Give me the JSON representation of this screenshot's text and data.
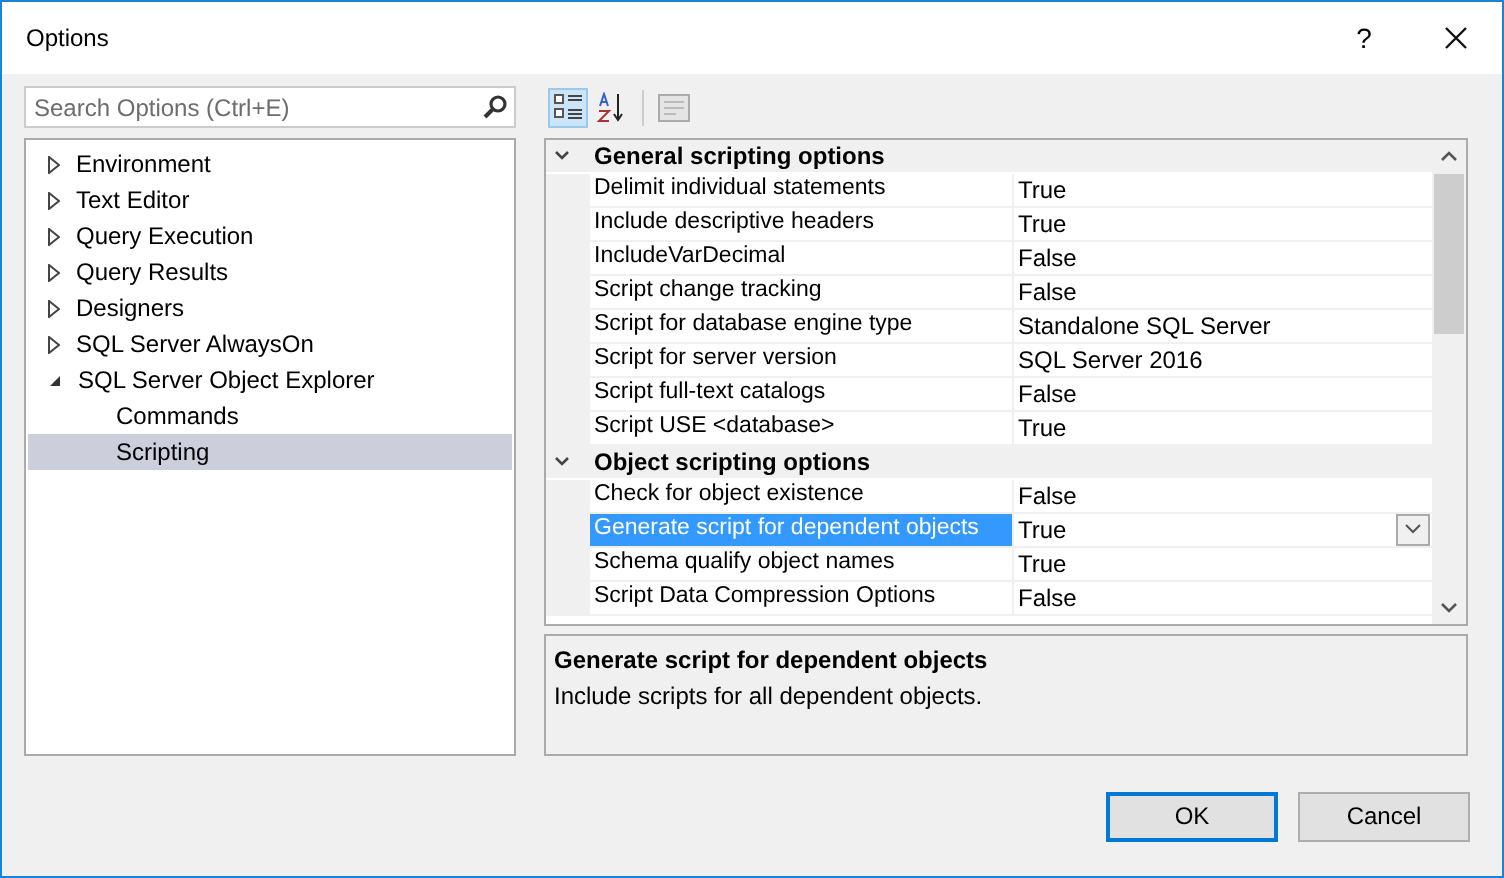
{
  "window": {
    "title": "Options",
    "help": "?"
  },
  "search": {
    "placeholder": "Search Options (Ctrl+E)"
  },
  "tree": [
    {
      "label": "Environment",
      "expanded": false,
      "selected": false
    },
    {
      "label": "Text Editor",
      "expanded": false,
      "selected": false
    },
    {
      "label": "Query Execution",
      "expanded": false,
      "selected": false
    },
    {
      "label": "Query Results",
      "expanded": false,
      "selected": false
    },
    {
      "label": "Designers",
      "expanded": false,
      "selected": false
    },
    {
      "label": "SQL Server AlwaysOn",
      "expanded": false,
      "selected": false
    },
    {
      "label": "SQL Server Object Explorer",
      "expanded": true,
      "selected": false,
      "children": [
        {
          "label": "Commands",
          "selected": false
        },
        {
          "label": "Scripting",
          "selected": true
        }
      ]
    }
  ],
  "toolbar": [
    {
      "kind": "categorized",
      "selected": true
    },
    {
      "kind": "alphabetical",
      "selected": false
    },
    {
      "kind": "pages",
      "selected": false
    }
  ],
  "grid": [
    {
      "category": "General scripting options",
      "expanded": true,
      "properties": [
        {
          "name": "Delimit individual statements",
          "value": "True",
          "selected": false
        },
        {
          "name": "Include descriptive headers",
          "value": "True",
          "selected": false
        },
        {
          "name": "IncludeVarDecimal",
          "value": "False",
          "selected": false
        },
        {
          "name": "Script change tracking",
          "value": "False",
          "selected": false
        },
        {
          "name": "Script for database engine type",
          "value": "Standalone SQL Server",
          "selected": false
        },
        {
          "name": "Script for server version",
          "value": "SQL Server 2016",
          "selected": false
        },
        {
          "name": "Script full-text catalogs",
          "value": "False",
          "selected": false
        },
        {
          "name": "Script USE <database>",
          "value": "True",
          "selected": false
        }
      ]
    },
    {
      "category": "Object scripting options",
      "expanded": true,
      "properties": [
        {
          "name": "Check for object existence",
          "value": "False",
          "selected": false
        },
        {
          "name": "Generate script for dependent objects",
          "value": "True",
          "selected": true
        },
        {
          "name": "Schema qualify object names",
          "value": "True",
          "selected": false
        },
        {
          "name": "Script Data Compression Options",
          "value": "False",
          "selected": false
        }
      ]
    }
  ],
  "description": {
    "title": "Generate script for dependent objects",
    "text": "Include scripts for all dependent objects."
  },
  "buttons": [
    {
      "label": "OK",
      "default": true
    },
    {
      "label": "Cancel",
      "default": false
    }
  ]
}
